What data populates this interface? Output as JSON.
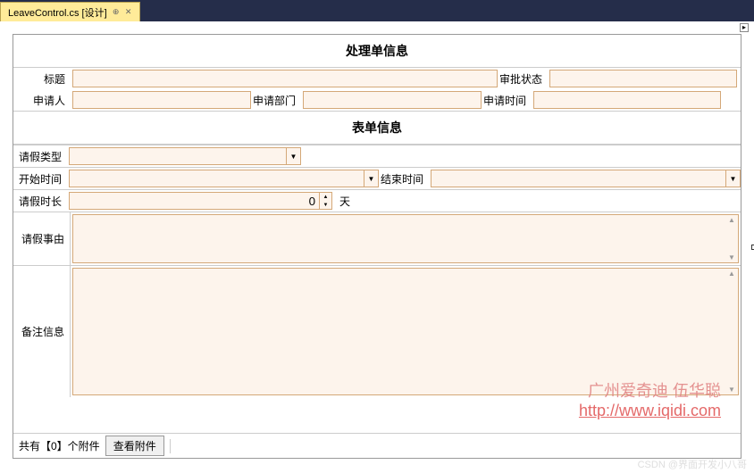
{
  "tab": {
    "title": "LeaveControl.cs [设计]",
    "pin_icon": "⊕",
    "close_icon": "✕"
  },
  "section1": {
    "title": "处理单信息"
  },
  "section2": {
    "title": "表单信息"
  },
  "fields": {
    "title_label": "标题",
    "status_label": "审批状态",
    "applicant_label": "申请人",
    "dept_label": "申请部门",
    "apply_time_label": "申请时间",
    "leave_type_label": "请假类型",
    "start_time_label": "开始时间",
    "end_time_label": "结束时间",
    "duration_label": "请假时长",
    "duration_value": "0",
    "duration_unit": "天",
    "reason_label": "请假事由",
    "remark_label": "备注信息"
  },
  "footer": {
    "attachment_text": "共有【0】个附件",
    "view_btn": "查看附件"
  },
  "watermark": {
    "name": "广州爱奇迪  伍华聪",
    "url": "http://www.iqidi.com"
  },
  "csdn": "CSDN @界面开发小八哥"
}
